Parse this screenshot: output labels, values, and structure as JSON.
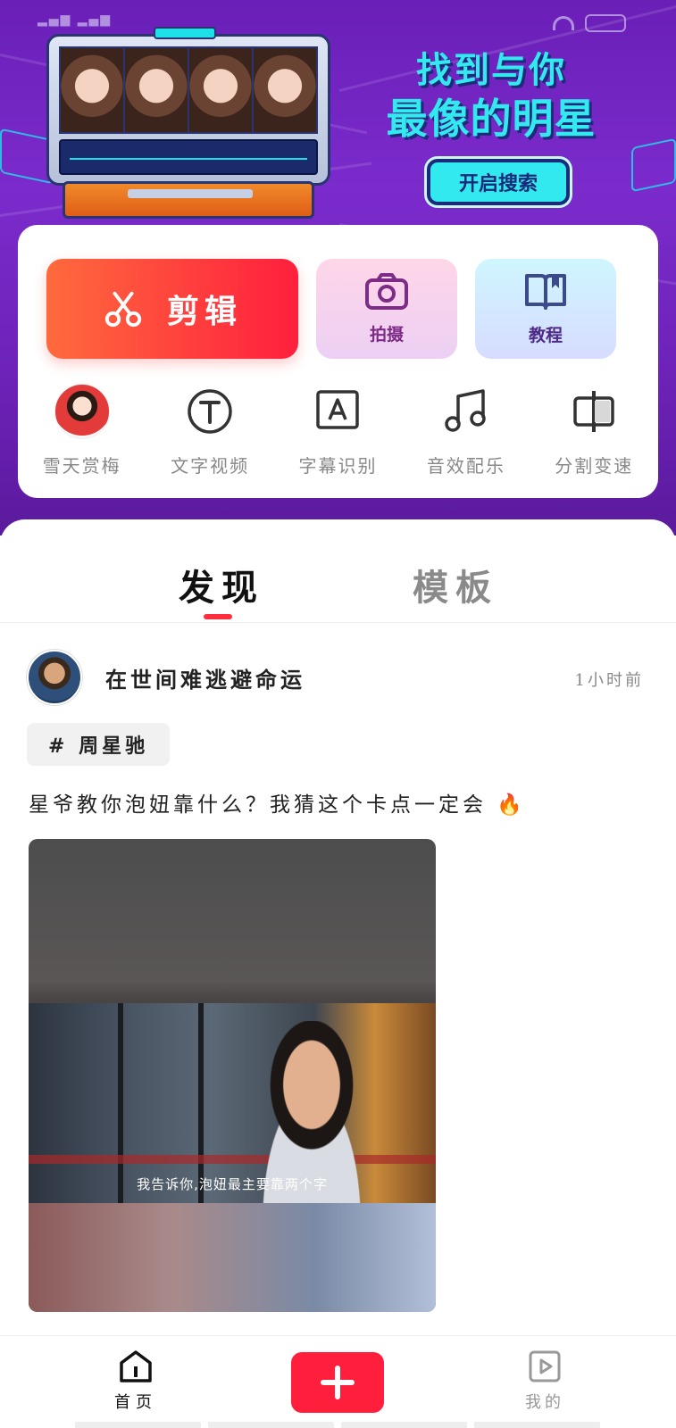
{
  "banner": {
    "title_line1": "找到与你",
    "title_line2": "最像的明星",
    "search_button": "开启搜索"
  },
  "tools": {
    "edit": "剪辑",
    "shoot": "拍摄",
    "tutorial": "教程",
    "mini": [
      {
        "label": "雪天赏梅",
        "icon": "avatar-thumbnail"
      },
      {
        "label": "文字视频",
        "icon": "text-t-icon"
      },
      {
        "label": "字幕识别",
        "icon": "subtitle-a-icon"
      },
      {
        "label": "音效配乐",
        "icon": "music-note-icon"
      },
      {
        "label": "分割变速",
        "icon": "split-icon"
      }
    ]
  },
  "feed": {
    "tabs": [
      {
        "label": "发现",
        "active": true
      },
      {
        "label": "模板",
        "active": false
      }
    ],
    "post": {
      "author": "在世间难逃避命运",
      "time": "1小时前",
      "hashtag": "# 周星驰",
      "caption": "星爷教你泡妞靠什么？我猜这个卡点一定会",
      "video_subtitle": "我告诉你,泡妞最主要靠两个字"
    }
  },
  "bottom_nav": {
    "home": "首页",
    "mine": "我的"
  },
  "colors": {
    "banner_purple": "#6a1fb7",
    "accent_cyan": "#31e9ee",
    "brand_red": "#ff1f3d"
  }
}
